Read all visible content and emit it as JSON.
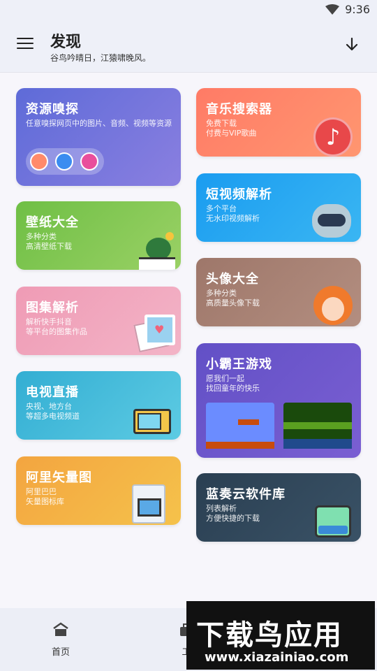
{
  "status": {
    "time": "9:36"
  },
  "appbar": {
    "title": "发现",
    "subtitle": "谷鸟吟晴日，江猿啸晚风。"
  },
  "cards": {
    "resource": {
      "title": "资源嗅探",
      "desc": "任意嗅探网页中的图片、音频、视频等资源"
    },
    "wallpaper": {
      "title": "壁纸大全",
      "desc1": "多种分类",
      "desc2": "高清壁纸下载"
    },
    "gallery": {
      "title": "图集解析",
      "desc1": "解析快手抖音",
      "desc2": "等平台的图集作品"
    },
    "tv": {
      "title": "电视直播",
      "desc1": "央视、地方台",
      "desc2": "等超多电视频道"
    },
    "vector": {
      "title": "阿里矢量图",
      "desc1": "阿里巴巴",
      "desc2": "矢量图标库"
    },
    "music": {
      "title": "音乐搜索器",
      "desc1": "免费下载",
      "desc2": "付费与VIP歌曲"
    },
    "shortvideo": {
      "title": "短视频解析",
      "desc1": "多个平台",
      "desc2": "无水印视频解析"
    },
    "avatar": {
      "title": "头像大全",
      "desc1": "多种分类",
      "desc2": "高质量头像下载"
    },
    "game": {
      "title": "小霸王游戏",
      "desc1": "愿我们一起",
      "desc2": "找回童年的快乐"
    },
    "lanzou": {
      "title": "蓝奏云软件库",
      "desc1": "列表解析",
      "desc2": "方便快捷的下载"
    }
  },
  "nav": {
    "home": "首页",
    "tools": "工"
  },
  "watermark": {
    "big": "下载鸟应用",
    "url": "www.xiazainiao.com"
  },
  "colors": {
    "resource": "#6a6fd6",
    "wallpaper": "#7cc24e",
    "gallery": "#ee9cb6",
    "tv": "#3cb6d6",
    "vector": "#f0a33e",
    "music": "#ff7d6a",
    "shortvideo": "#1aa2ee",
    "avatar": "#a07a6e",
    "game": "#6c51c4",
    "lanzou": "#2c4356"
  }
}
